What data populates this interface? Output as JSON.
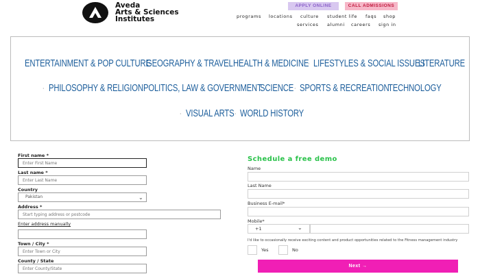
{
  "header": {
    "brand_line1": "Aveda",
    "brand_line2": "Arts & Sciences",
    "brand_line3": "Institutes",
    "apply_label": "APPLY ONLINE",
    "call_label": "CALL ADMISSIONS",
    "nav_row1": [
      "programs",
      "locations",
      "culture",
      "student life",
      "faqs",
      "shop"
    ],
    "nav_row2": [
      "services",
      "alumni",
      "careers",
      "sign in"
    ]
  },
  "topics": {
    "row1": [
      "ENTERTAINMENT & POP CULTURE",
      "GEOGRAPHY & TRAVEL",
      "HEALTH & MEDICINE",
      "LIFESTYLES & SOCIAL ISSUES",
      "LITERATURE"
    ],
    "row2": [
      "PHILOSOPHY & RELIGION",
      "POLITICS, LAW & GOVERNMENT",
      "SCIENCE",
      "SPORTS & RECREATION",
      "TECHNOLOGY"
    ],
    "row3": [
      "VISUAL ARTS",
      "WORLD HISTORY"
    ],
    "separator": "·"
  },
  "left_form": {
    "first_name_label": "First name *",
    "first_name_placeholder": "Enter First Name",
    "last_name_label": "Last name *",
    "last_name_placeholder": "Enter Last Name",
    "country_label": "Country",
    "country_value": "Pakistan",
    "address_label": "Address *",
    "address_placeholder": "Start typing address or postcode",
    "manual_link": "Enter address manually",
    "town_label": "Town / City *",
    "town_placeholder": "Enter Town or City",
    "county_label": "County / State",
    "county_placeholder": "Enter County/State"
  },
  "right_form": {
    "title": "Schedule a free demo",
    "name_label": "Name",
    "last_name_label": "Last Name",
    "email_label": "Business E-mail*",
    "mobile_label": "Mobile*",
    "mobile_code": "+1",
    "consent_text": "I'd like to occasionally receive exciting content and product opportunities related to the Fitness management industry",
    "yes_label": "Yes",
    "no_label": "No",
    "next_label": "Next →"
  },
  "colors": {
    "topic_blue": "#1e5f9c",
    "demo_green": "#29c24a",
    "next_magenta": "#f01fb5",
    "apply_bg": "#d8c8f0",
    "call_bg": "#f6b7c8"
  }
}
